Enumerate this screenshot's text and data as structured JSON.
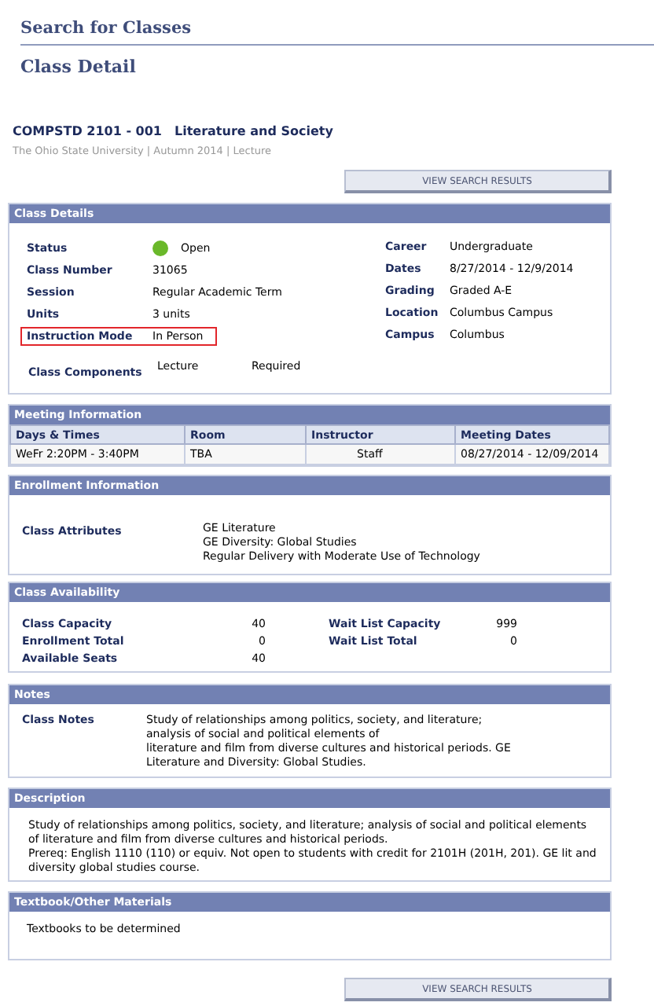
{
  "page_title": "Search for Classes",
  "heading": "Class Detail",
  "course": {
    "code": "COMPSTD 2101 - 001",
    "name": "Literature and Society",
    "subtitle": "The Ohio State University | Autumn 2014 | Lecture"
  },
  "top_button": "VIEW SEARCH RESULTS",
  "class_details": {
    "title": "Class Details",
    "left": [
      {
        "kind": "status",
        "label": "Status",
        "value": "Open",
        "color": "#6ab82a",
        "highlighted": false
      },
      {
        "kind": "text",
        "label": "Class Number",
        "value": "31065",
        "highlighted": false
      },
      {
        "kind": "text",
        "label": "Session",
        "value": "Regular Academic Term",
        "highlighted": false
      },
      {
        "kind": "text",
        "label": "Units",
        "value": "3 units",
        "highlighted": false
      },
      {
        "kind": "text",
        "label": "Instruction Mode",
        "value": "In Person",
        "highlighted": true
      }
    ],
    "right": [
      {
        "label": "Career",
        "value": "Undergraduate"
      },
      {
        "label": "Dates",
        "value": "8/27/2014 - 12/9/2014"
      },
      {
        "label": "Grading",
        "value": "Graded A-E"
      },
      {
        "label": "Location",
        "value": "Columbus Campus"
      },
      {
        "label": "Campus",
        "value": "Columbus"
      }
    ],
    "components": {
      "label": "Class Components",
      "value": "Lecture",
      "requirement": "Required"
    }
  },
  "meeting": {
    "title": "Meeting Information",
    "columns": [
      "Days & Times",
      "Room",
      "Instructor",
      "Meeting Dates"
    ],
    "rows": [
      [
        "WeFr 2:20PM - 3:40PM",
        "TBA",
        "Staff",
        "08/27/2014 - 12/09/2014"
      ]
    ]
  },
  "enrollment": {
    "title": "Enrollment Information",
    "label": "Class Attributes",
    "attributes": [
      "GE Literature",
      "GE Diversity: Global Studies",
      "Regular Delivery with Moderate Use of Technology"
    ]
  },
  "availability": {
    "title": "Class Availability",
    "left": [
      {
        "label": "Class Capacity",
        "value": "40"
      },
      {
        "label": "Enrollment Total",
        "value": "0"
      },
      {
        "label": "Available Seats",
        "value": "40"
      }
    ],
    "right": [
      {
        "label": "Wait List Capacity",
        "value": "999"
      },
      {
        "label": "Wait List Total",
        "value": "0"
      }
    ]
  },
  "notes": {
    "title": "Notes",
    "label": "Class Notes",
    "lines": [
      "Study of relationships among politics, society, and literature;",
      "analysis of social and political elements of",
      "literature and film from diverse cultures and historical periods. GE",
      "Literature and Diversity: Global Studies."
    ]
  },
  "description": {
    "title": "Description",
    "paragraphs": [
      "Study of relationships among politics, society, and literature; analysis of social and political elements of literature and film from diverse cultures and historical periods.",
      "Prereq: English 1110 (110) or equiv. Not open to students with credit for 2101H (201H, 201). GE lit and diversity global studies course."
    ]
  },
  "textbook": {
    "title": "Textbook/Other Materials",
    "text": "Textbooks to be determined"
  },
  "bottom_button": "VIEW SEARCH RESULTS"
}
